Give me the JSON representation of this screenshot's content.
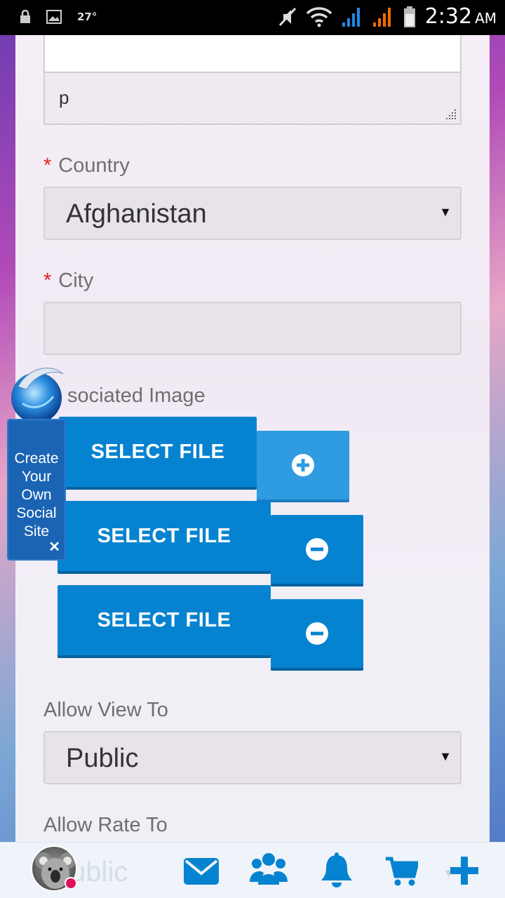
{
  "status_bar": {
    "temperature": "27°",
    "time": "2:32",
    "ampm": "AM"
  },
  "form": {
    "textarea_value": "p",
    "country": {
      "required_mark": "*",
      "label": "Country",
      "selected": "Afghanistan"
    },
    "city": {
      "required_mark": "*",
      "label": "City",
      "value": ""
    },
    "associated_image": {
      "label": "sociated Image",
      "select_file_buttons": [
        "SELECT FILE",
        "SELECT FILE",
        "SELECT FILE"
      ]
    },
    "allow_view_to": {
      "label": "Allow View To",
      "selected": "Public"
    },
    "allow_rate_to": {
      "label": "Allow Rate To",
      "selected": "Public"
    }
  },
  "widget": {
    "line1": "Create",
    "line2": "Your",
    "line3": "Own",
    "line4": "Social",
    "line5": "Site",
    "close": "✕"
  },
  "bottom_nav": {
    "ghost_value": "ublic",
    "icons": [
      "avatar",
      "mail-icon",
      "friends-icon",
      "bell-icon",
      "cart-icon",
      "plus-icon"
    ]
  },
  "colors": {
    "primary_button": "#0683d0",
    "required": "#e02020",
    "nav_icon": "#0683d0"
  }
}
